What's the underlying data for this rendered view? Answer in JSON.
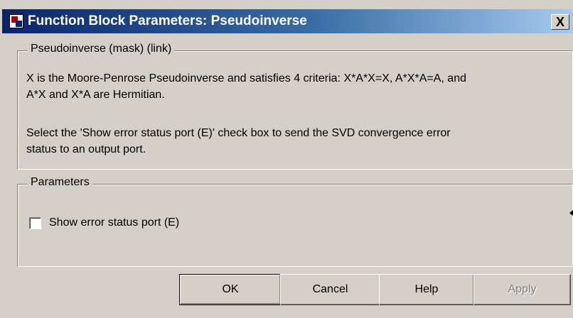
{
  "window": {
    "title": "Function Block Parameters: Pseudoinverse",
    "close_label": "X"
  },
  "description_group": {
    "legend": "Pseudoinverse (mask) (link)",
    "line1": "X is the Moore-Penrose Pseudoinverse and satisfies 4 criteria: X*A*X=X, A*X*A=A, and",
    "line2": "A*X and X*A are Hermitian.",
    "line3": "Select the 'Show error status port (E)' check box to send the SVD convergence error",
    "line4": "status to an output port."
  },
  "parameters_group": {
    "legend": "Parameters",
    "checkbox_label": "Show error status port (E)",
    "checkbox_checked": false
  },
  "buttons": {
    "ok": "OK",
    "cancel": "Cancel",
    "help": "Help",
    "apply": "Apply"
  },
  "colors": {
    "face": "#d4d0c8",
    "title_start": "#0a246a",
    "title_end": "#a6caf0"
  }
}
